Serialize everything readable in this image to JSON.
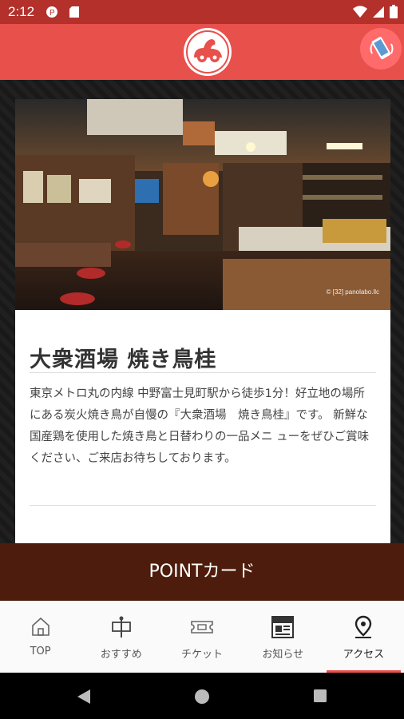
{
  "status_bar": {
    "time": "2:12"
  },
  "header": {
    "logo_icon": "bird-logo-icon",
    "call_button_icon": "phone-icon"
  },
  "hero_image": {
    "credit": "© [32] panolabo.llc"
  },
  "shop": {
    "title": "大衆酒場 焼き鳥桂",
    "description": "東京メトロ丸の内線 中野富士見町駅から徒歩1分！好立地の場所にある炭火焼き鳥が自慢の『大衆酒場　焼き鳥桂』です。 新鮮な国産鶏を使用した焼き鳥と日替わりの一品メニ ューをぜひご賞味ください、ご来店お待ちしております。"
  },
  "point_card": {
    "label": "POINTカード"
  },
  "bottom_nav": {
    "items": [
      {
        "label": "TOP",
        "icon": "home-icon"
      },
      {
        "label": "おすすめ",
        "icon": "signboard-icon"
      },
      {
        "label": "チケット",
        "icon": "ticket-icon"
      },
      {
        "label": "お知らせ",
        "icon": "news-icon"
      },
      {
        "label": "アクセス",
        "icon": "location-pin-icon"
      }
    ],
    "active_index": 4
  },
  "colors": {
    "header": "#e8504c",
    "status_bar": "#b3302b",
    "point_bar": "#4e1c0c",
    "active_tab": "#e8504c"
  }
}
